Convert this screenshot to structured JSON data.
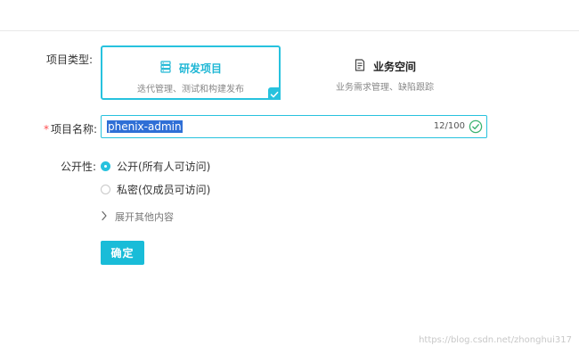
{
  "form": {
    "project_type_label": "项目类型:",
    "project_types": [
      {
        "title": "研发项目",
        "description": "迭代管理、测试和构建发布",
        "icon": "server-stack-icon",
        "selected": true
      },
      {
        "title": "业务空间",
        "description": "业务需求管理、缺陷跟踪",
        "icon": "document-icon",
        "selected": false
      }
    ],
    "name_required_mark": "*",
    "name_label": "项目名称:",
    "name_value": "phenix-admin",
    "name_count": "12/100",
    "visibility_label": "公开性:",
    "visibility_options": [
      {
        "label": "公开(所有人可访问)",
        "checked": true
      },
      {
        "label": "私密(仅成员可访问)",
        "checked": false
      }
    ],
    "expand_label": "展开其他内容",
    "submit_label": "确定"
  },
  "watermark": "https://blog.csdn.net/zhonghui317",
  "colors": {
    "accent": "#27c2de",
    "selection": "#2f6fd6",
    "success": "#3cb371",
    "required": "#ff4d4f"
  }
}
